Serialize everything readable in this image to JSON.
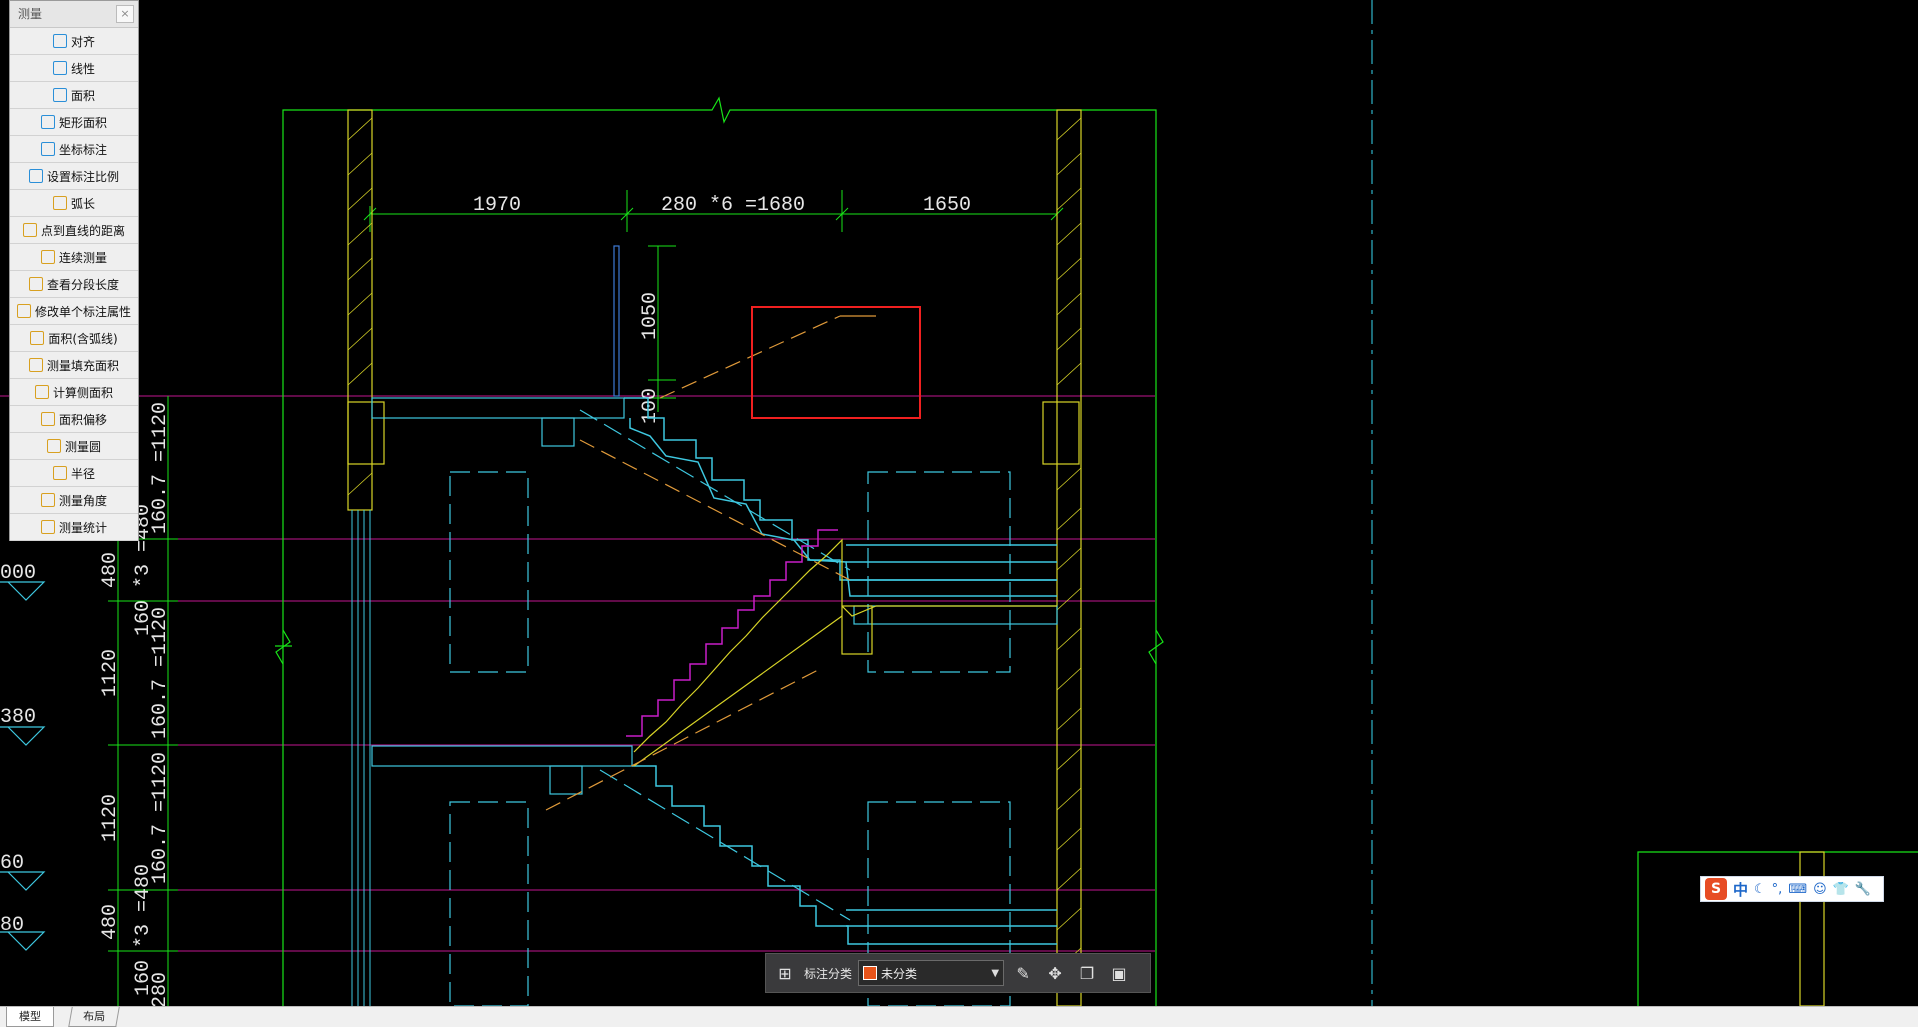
{
  "measure_panel": {
    "title": "测量",
    "close": "×",
    "tools": [
      {
        "label": "对齐",
        "icon": "aligned-dimension-icon"
      },
      {
        "label": "线性",
        "icon": "linear-dimension-icon"
      },
      {
        "label": "面积",
        "icon": "area-icon"
      },
      {
        "label": "矩形面积",
        "icon": "rectangle-area-icon"
      },
      {
        "label": "坐标标注",
        "icon": "coordinate-icon"
      },
      {
        "label": "设置标注比例",
        "icon": "scale-icon"
      },
      {
        "label": "弧长",
        "icon": "arc-length-icon"
      },
      {
        "label": "点到直线的距离",
        "icon": "point-line-distance-icon"
      },
      {
        "label": "连续测量",
        "icon": "continuous-measure-icon"
      },
      {
        "label": "查看分段长度",
        "icon": "segment-length-icon"
      },
      {
        "label": "修改单个标注属性",
        "icon": "edit-dimension-icon"
      },
      {
        "label": "面积(含弧线)",
        "icon": "arc-area-icon"
      },
      {
        "label": "测量填充面积",
        "icon": "hatch-area-icon"
      },
      {
        "label": "计算侧面积",
        "icon": "side-area-icon"
      },
      {
        "label": "面积偏移",
        "icon": "area-offset-icon"
      },
      {
        "label": "测量圆",
        "icon": "circle-icon"
      },
      {
        "label": "半径",
        "icon": "radius-icon"
      },
      {
        "label": "测量角度",
        "icon": "angle-icon"
      },
      {
        "label": "测量统计",
        "icon": "statistics-icon"
      }
    ]
  },
  "drawing": {
    "top_dims": [
      "1970",
      "280 *6 =1680",
      "1650"
    ],
    "vert_dims": [
      "1050",
      "100"
    ],
    "left_dims_inner": [
      "160.7 =1120",
      "160 *3 =4",
      "160.7 =1120",
      "160.7 =1120",
      "160 *3 =480"
    ],
    "left_dims_outer": [
      "480",
      "1120",
      "1120",
      "480",
      "280"
    ],
    "left_levels": [
      "000",
      "380",
      "60",
      "80"
    ]
  },
  "anno_bar": {
    "label": "标注分类",
    "selected": "未分类"
  },
  "ime": {
    "zh": "中",
    "punct": "°,"
  },
  "tabs": {
    "model": "模型",
    "layout": "布局"
  }
}
